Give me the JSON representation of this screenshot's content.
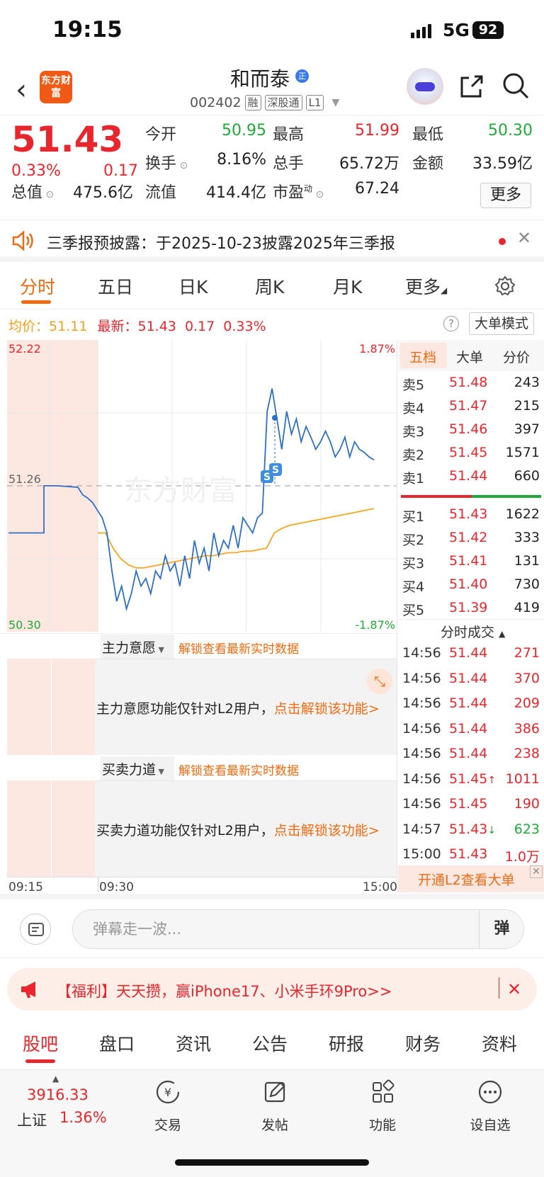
{
  "status": {
    "time": "19:15",
    "network": "5G",
    "battery": "92"
  },
  "header": {
    "logo": "东方财富",
    "name": "和而泰",
    "badge": "正",
    "code": "002402",
    "tags": [
      "融",
      "深股通",
      "L1"
    ]
  },
  "quote": {
    "price": "51.43",
    "change_pct": "0.33%",
    "change": "0.17",
    "rows": [
      [
        {
          "label": "今开",
          "value": "50.95",
          "color": "green"
        },
        {
          "label": "最高",
          "value": "51.99",
          "color": "red"
        },
        {
          "label": "最低",
          "value": "50.30",
          "color": "green"
        }
      ],
      [
        {
          "label": "换手",
          "value": "8.16%",
          "color": "dark"
        },
        {
          "label": "总手",
          "value": "65.72万",
          "color": "dark"
        },
        {
          "label": "金额",
          "value": "33.59亿",
          "color": "dark"
        }
      ],
      [
        {
          "label": "总值",
          "value": "475.6亿",
          "color": "dark"
        },
        {
          "label": "流值",
          "value": "414.4亿",
          "color": "dark"
        },
        {
          "label": "市盈",
          "value": "67.24",
          "color": "dark",
          "sup": "动"
        }
      ]
    ],
    "more": "更多"
  },
  "notice": {
    "text": "三季报预披露：于2025-10-23披露2025年三季报"
  },
  "tabs": [
    "分时",
    "五日",
    "日K",
    "周K",
    "月K",
    "更多"
  ],
  "info": {
    "avg_label": "均价：",
    "avg": "51.11",
    "latest_label": "最新：",
    "latest": "51.43",
    "chg": "0.17",
    "pct": "0.33%",
    "mode": "大单模式"
  },
  "chart_data": {
    "type": "line",
    "y_top": "52.22",
    "y_mid": "51.26",
    "y_bot": "50.30",
    "pct_top": "1.87%",
    "pct_bot": "-1.87%",
    "x_labels": [
      "09:15",
      "09:30",
      "15:00"
    ],
    "watermark": "东方财富",
    "series": [
      {
        "values": [
          50.95,
          50.95,
          51.26,
          51.26,
          51.25,
          51.2,
          51.18,
          51.15,
          51.1,
          51.05,
          50.95,
          50.7,
          50.5,
          50.6,
          50.45,
          50.55,
          50.7,
          50.6,
          50.65,
          50.55,
          50.7,
          50.65,
          50.8,
          50.7,
          50.75,
          50.6,
          50.8,
          50.65,
          50.9,
          50.75,
          50.85,
          50.7,
          50.95,
          50.8,
          50.9,
          50.85,
          51.0,
          50.85,
          51.05,
          51.0,
          50.95,
          51.05,
          51.08,
          51.75,
          51.9,
          51.7,
          51.5,
          51.75,
          51.6,
          51.7,
          51.55,
          51.65,
          51.58,
          51.5,
          51.55,
          51.62,
          51.55,
          51.45,
          51.5,
          51.58,
          51.45,
          51.55,
          51.5,
          51.48,
          51.45,
          51.43
        ]
      },
      {
        "values": [
          50.95,
          50.95,
          50.85,
          50.78,
          50.74,
          50.72,
          50.72,
          50.73,
          50.74,
          50.75,
          50.76,
          50.77,
          50.78,
          50.79,
          50.8,
          50.8,
          50.81,
          50.82,
          50.82,
          50.83,
          50.83,
          50.84,
          50.85,
          50.95,
          50.98,
          51.0,
          51.01,
          51.02,
          51.03,
          51.04,
          51.05,
          51.06,
          51.07,
          51.08,
          51.09,
          51.1,
          51.11
        ]
      }
    ]
  },
  "orderbook": {
    "tabs": [
      "五档",
      "大单",
      "分价"
    ],
    "sell": [
      [
        "卖5",
        "51.48",
        "243"
      ],
      [
        "卖4",
        "51.47",
        "215"
      ],
      [
        "卖3",
        "51.46",
        "397"
      ],
      [
        "卖2",
        "51.45",
        "1571"
      ],
      [
        "卖1",
        "51.44",
        "660"
      ]
    ],
    "buy": [
      [
        "买1",
        "51.43",
        "1622"
      ],
      [
        "买2",
        "51.42",
        "333"
      ],
      [
        "买3",
        "51.41",
        "131"
      ],
      [
        "买4",
        "51.40",
        "730"
      ],
      [
        "买5",
        "51.39",
        "419"
      ]
    ],
    "trades_title": "分时成交",
    "trades": [
      [
        "14:56",
        "51.44",
        "271"
      ],
      [
        "14:56",
        "51.44",
        "370"
      ],
      [
        "14:56",
        "51.44",
        "209"
      ],
      [
        "14:56",
        "51.44",
        "386"
      ],
      [
        "14:56",
        "51.44",
        "238"
      ],
      [
        "14:56",
        "51.45↑",
        "1011"
      ],
      [
        "14:56",
        "51.45",
        "190"
      ],
      [
        "14:57",
        "51.43↓",
        "623"
      ],
      [
        "15:00",
        "51.43",
        "1.0万"
      ]
    ],
    "l2": "开通L2查看大单"
  },
  "panels": [
    {
      "title": "主力意愿",
      "link": "解锁查看最新实时数据",
      "msg": "主力意愿功能仅针对L2用户，",
      "msg_link": "点击解锁该功能>"
    },
    {
      "title": "买卖力道",
      "link": "解锁查看最新实时数据",
      "msg": "买卖力道功能仅针对L2用户，",
      "msg_link": "点击解锁该功能>"
    }
  ],
  "danmu": {
    "placeholder": "弹幕走一波...",
    "btn": "弹"
  },
  "promo": {
    "text": "【福利】天天攒，赢iPhone17、小米手环9Pro>>"
  },
  "bottom_tabs": [
    "股吧",
    "盘口",
    "资讯",
    "公告",
    "研报",
    "财务",
    "资料"
  ],
  "bottom_bar": {
    "index_value": "3916.33",
    "index_name": "上证",
    "index_pct": "1.36%",
    "items": [
      "交易",
      "发帖",
      "功能",
      "设自选"
    ]
  }
}
